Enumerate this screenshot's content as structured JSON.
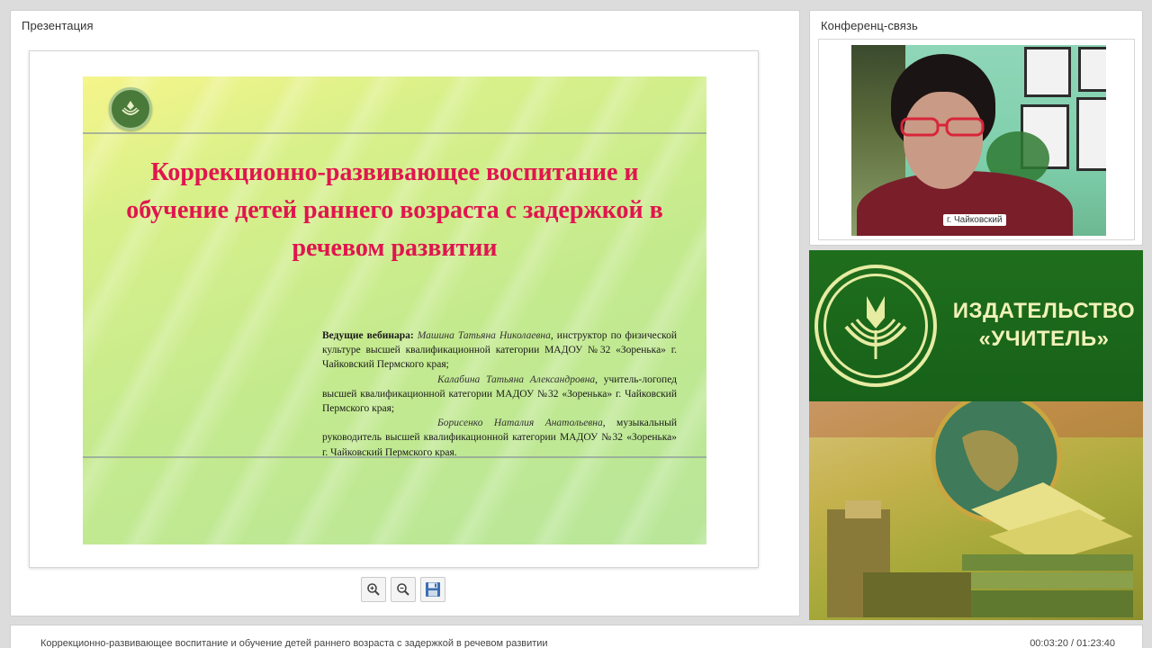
{
  "presentation": {
    "title": "Презентация",
    "slide": {
      "heading": "Коррекционно-развивающее воспитание и обучение детей раннего возраста с задержкой в речевом развитии",
      "hosts_label": "Ведущие вебинара:",
      "host1_name": "Машина Татьяна Николаевна",
      "host1_role": ", инструктор по физической культуре высшей квалификационной категории МАДОУ №32 «Зоренька» г. Чайковский Пермского края;",
      "host2_name": "Калабина Татьяна Александровна",
      "host2_role": ", учитель-логопед высшей квалификационной категории МАДОУ №32 «Зоренька» г. Чайковский Пермского края;",
      "host3_name": "Борисенко Наталия Анатольевна",
      "host3_role": ", музыкальный руководитель высшей квалификационной категории МАДОУ №32 «Зоренька» г. Чайковский Пермского края."
    },
    "toolbar": {
      "zoom_in_icon": "zoom-in-icon",
      "zoom_out_icon": "zoom-out-icon",
      "save_icon": "floppy-disk-icon"
    }
  },
  "conference": {
    "title": "Конференц-связь",
    "video_label": "г. Чайковский"
  },
  "banner": {
    "line1": "ИЗДАТЕЛЬСТВО",
    "line2": "«УЧИТЕЛЬ»",
    "brand_color": "#1f6e1c",
    "text_color": "#f1f2b8"
  },
  "footer": {
    "title": "Коррекционно-развивающее воспитание и обучение детей раннего возраста с задержкой в речевом развитии",
    "time": "00:03:20 / 01:23:40"
  },
  "colors": {
    "slide_title": "#e0154f"
  }
}
